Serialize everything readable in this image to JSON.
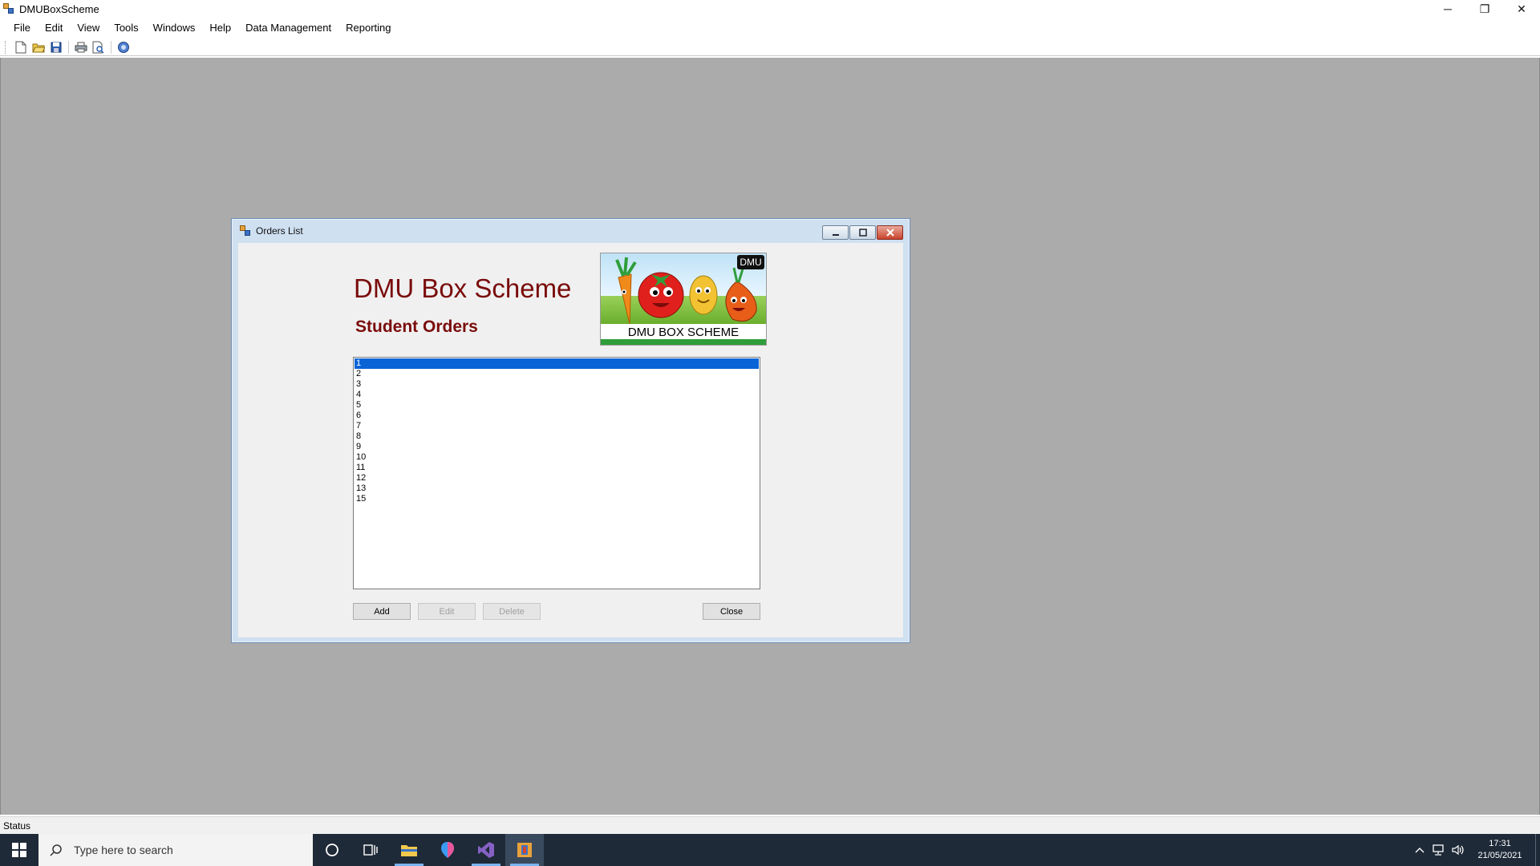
{
  "app": {
    "title": "DMUBoxScheme",
    "minimize": "─",
    "restore": "❐",
    "close": "✕"
  },
  "menubar": {
    "items": [
      "File",
      "Edit",
      "View",
      "Tools",
      "Windows",
      "Help",
      "Data Management",
      "Reporting"
    ]
  },
  "toolbar": {
    "buttons": [
      "new-icon",
      "open-icon",
      "save-icon",
      "print-icon",
      "print-preview-icon",
      "help-icon"
    ]
  },
  "child_window": {
    "title": "Orders List",
    "brand_title": "DMU Box Scheme",
    "subtitle": "Student Orders",
    "logo": {
      "badge": "DMU",
      "text": "DMU BOX SCHEME"
    },
    "list_items": [
      "1",
      "2",
      "3",
      "4",
      "5",
      "6",
      "7",
      "8",
      "9",
      "10",
      "11",
      "12",
      "13",
      "15"
    ],
    "selected_index": 0,
    "buttons": {
      "add": "Add",
      "edit": "Edit",
      "delete": "Delete",
      "close": "Close"
    }
  },
  "statusbar": {
    "text": "Status"
  },
  "taskbar": {
    "search_placeholder": "Type here to search",
    "time": "17:31",
    "date": "21/05/2021"
  },
  "colors": {
    "brand": "#7a0b0b",
    "selection": "#0a64d6",
    "mdi_background": "#ababab",
    "taskbar": "#1f2a38"
  }
}
